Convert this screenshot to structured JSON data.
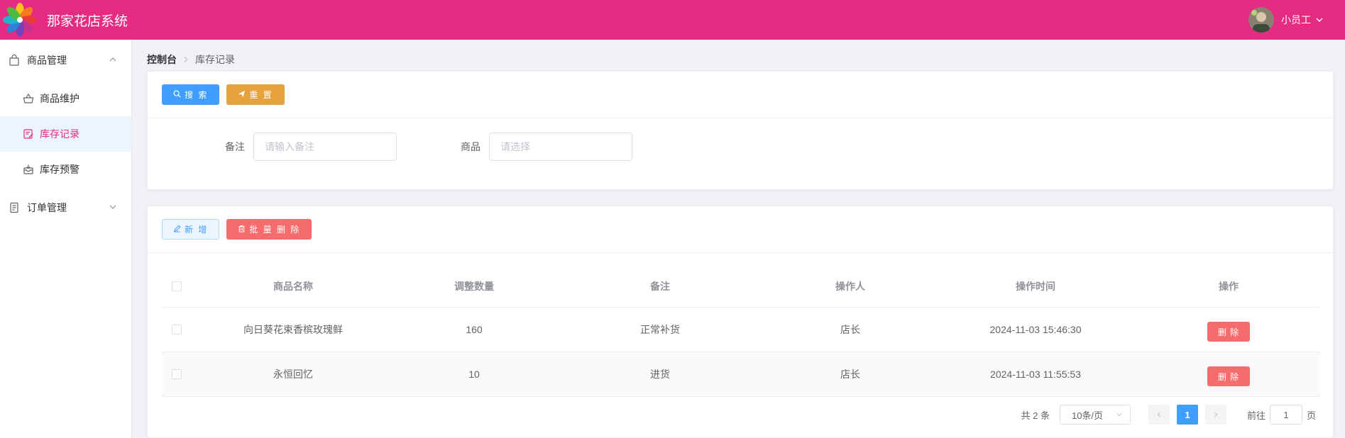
{
  "app": {
    "title": "那家花店系统",
    "user_name": "小员工",
    "brand_color": "#e62b83"
  },
  "sidebar": {
    "groups": [
      {
        "label": "商品管理",
        "icon": "shopping-bag-icon",
        "expanded": true,
        "items": [
          {
            "label": "商品维护",
            "icon": "basket-icon"
          },
          {
            "label": "库存记录",
            "icon": "edit-list-icon",
            "active": true
          },
          {
            "label": "库存预警",
            "icon": "inbox-icon"
          }
        ]
      },
      {
        "label": "订单管理",
        "icon": "document-icon",
        "expanded": false
      }
    ]
  },
  "breadcrumb": {
    "root": "控制台",
    "current": "库存记录"
  },
  "search_card": {
    "search_label": "搜 索",
    "reset_label": "重 置",
    "note_label": "备注",
    "note_placeholder": "请输入备注",
    "product_label": "商品",
    "product_placeholder": "请选择"
  },
  "table_card": {
    "add_label": "新 增",
    "batch_delete_label": "批 量 删 除",
    "columns": [
      "商品名称",
      "调整数量",
      "备注",
      "操作人",
      "操作时间",
      "操作"
    ],
    "rows": [
      {
        "name": "向日葵花束香槟玫瑰鲜",
        "qty": "160",
        "note": "正常补货",
        "operator": "店长",
        "time": "2024-11-03 15:46:30",
        "action": "删 除"
      },
      {
        "name": "永恒回忆",
        "qty": "10",
        "note": "进货",
        "operator": "店长",
        "time": "2024-11-03 11:55:53",
        "action": "删 除"
      }
    ]
  },
  "pagination": {
    "total_text": "共 2 条",
    "page_size": "10条/页",
    "current_page": "1",
    "goto_prefix": "前往",
    "goto_value": "1",
    "goto_suffix": "页"
  }
}
